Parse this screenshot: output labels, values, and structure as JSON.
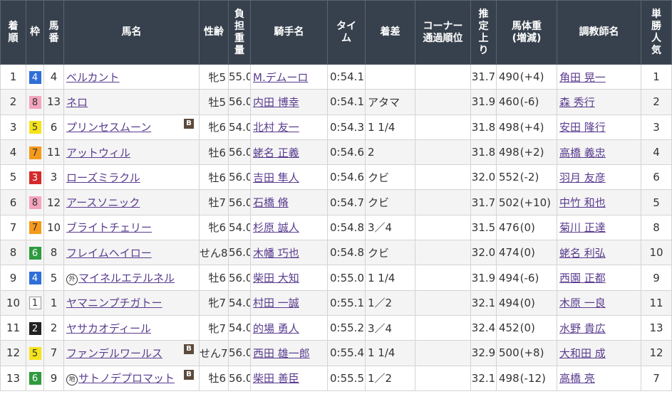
{
  "headers": {
    "finish": [
      "着",
      "順"
    ],
    "waku": [
      "枠"
    ],
    "umaban": [
      "馬",
      "番"
    ],
    "horse": [
      "馬名"
    ],
    "sexage": [
      "性齢"
    ],
    "weight": [
      "負",
      "担",
      "重",
      "量"
    ],
    "jockey": [
      "騎手名"
    ],
    "time": [
      "タイ",
      "ム"
    ],
    "margin": [
      "着差"
    ],
    "corner": [
      "コーナー",
      "通過順位"
    ],
    "last3f": [
      "推",
      "定",
      "上",
      "り"
    ],
    "bodyweight": [
      "馬体重",
      "(増減)"
    ],
    "trainer": [
      "調教師名"
    ],
    "popularity": [
      "単",
      "勝",
      "人",
      "気"
    ]
  },
  "waku_colors": {
    "1": {
      "bg": "#ffffff",
      "fg": "#333333",
      "border": "#999999"
    },
    "2": {
      "bg": "#222222",
      "fg": "#ffffff",
      "border": "#222222"
    },
    "3": {
      "bg": "#d42a2a",
      "fg": "#ffffff",
      "border": "#d42a2a"
    },
    "4": {
      "bg": "#2f6fd6",
      "fg": "#ffffff",
      "border": "#2f6fd6"
    },
    "5": {
      "bg": "#f5e21b",
      "fg": "#333333",
      "border": "#f5e21b"
    },
    "6": {
      "bg": "#2f9a3e",
      "fg": "#ffffff",
      "border": "#2f9a3e"
    },
    "7": {
      "bg": "#f59a1b",
      "fg": "#333333",
      "border": "#f59a1b"
    },
    "8": {
      "bg": "#f5a3bd",
      "fg": "#333333",
      "border": "#f5a3bd"
    }
  },
  "rows": [
    {
      "finish": "1",
      "waku": "4",
      "umaban": "4",
      "mark": "",
      "horse": "ベルカント",
      "blinker": "",
      "sexage": "牝5",
      "weight": "55.0",
      "jockey": "M.デムーロ",
      "time": "0:54.1",
      "margin": "",
      "corner": "",
      "last3f": "31.7",
      "bw": "490",
      "bwdiff": "(+4)",
      "trainer": "角田 晃一",
      "pop": "1"
    },
    {
      "finish": "2",
      "waku": "8",
      "umaban": "13",
      "mark": "",
      "horse": "ネロ",
      "blinker": "",
      "sexage": "牡5",
      "weight": "56.0",
      "jockey": "内田 博幸",
      "time": "0:54.1",
      "margin": "アタマ",
      "corner": "",
      "last3f": "31.9",
      "bw": "460",
      "bwdiff": "(-6)",
      "trainer": "森 秀行",
      "pop": "2"
    },
    {
      "finish": "3",
      "waku": "5",
      "umaban": "6",
      "mark": "",
      "horse": "プリンセスムーン",
      "blinker": "B",
      "sexage": "牝6",
      "weight": "54.0",
      "jockey": "北村 友一",
      "time": "0:54.3",
      "margin": "1 1/4",
      "corner": "",
      "last3f": "31.8",
      "bw": "498",
      "bwdiff": "(+4)",
      "trainer": "安田 隆行",
      "pop": "3"
    },
    {
      "finish": "4",
      "waku": "7",
      "umaban": "11",
      "mark": "",
      "horse": "アットウィル",
      "blinker": "",
      "sexage": "牡6",
      "weight": "56.0",
      "jockey": "蛯名 正義",
      "time": "0:54.6",
      "margin": "2",
      "corner": "",
      "last3f": "31.8",
      "bw": "498",
      "bwdiff": "(+2)",
      "trainer": "高橋 義忠",
      "pop": "4"
    },
    {
      "finish": "5",
      "waku": "3",
      "umaban": "3",
      "mark": "",
      "horse": "ローズミラクル",
      "blinker": "",
      "sexage": "牡6",
      "weight": "56.0",
      "jockey": "吉田 隼人",
      "time": "0:54.6",
      "margin": "クビ",
      "corner": "",
      "last3f": "32.0",
      "bw": "552",
      "bwdiff": "(-2)",
      "trainer": "羽月 友彦",
      "pop": "6"
    },
    {
      "finish": "6",
      "waku": "8",
      "umaban": "12",
      "mark": "",
      "horse": "アースソニック",
      "blinker": "",
      "sexage": "牡7",
      "weight": "56.0",
      "jockey": "石橋 脩",
      "time": "0:54.7",
      "margin": "クビ",
      "corner": "",
      "last3f": "31.7",
      "bw": "502",
      "bwdiff": "(+10)",
      "trainer": "中竹 和也",
      "pop": "5"
    },
    {
      "finish": "7",
      "waku": "7",
      "umaban": "10",
      "mark": "",
      "horse": "ブライトチェリー",
      "blinker": "",
      "sexage": "牝6",
      "weight": "54.0",
      "jockey": "杉原 誠人",
      "time": "0:54.8",
      "margin": "3／4",
      "corner": "",
      "last3f": "31.5",
      "bw": "476",
      "bwdiff": "(0)",
      "trainer": "菊川 正達",
      "pop": "8"
    },
    {
      "finish": "8",
      "waku": "6",
      "umaban": "8",
      "mark": "",
      "horse": "フレイムヘイロー",
      "blinker": "",
      "sexage": "せん8",
      "weight": "56.0",
      "jockey": "木幡 巧也",
      "time": "0:54.8",
      "margin": "クビ",
      "corner": "",
      "last3f": "32.0",
      "bw": "474",
      "bwdiff": "(0)",
      "trainer": "蛯名 利弘",
      "pop": "10"
    },
    {
      "finish": "9",
      "waku": "4",
      "umaban": "5",
      "mark": "外",
      "horse": "マイネルエテルネル",
      "blinker": "",
      "sexage": "牡6",
      "weight": "56.0",
      "jockey": "柴田 大知",
      "time": "0:55.0",
      "margin": "1 1/4",
      "corner": "",
      "last3f": "31.9",
      "bw": "494",
      "bwdiff": "(-6)",
      "trainer": "西園 正都",
      "pop": "9"
    },
    {
      "finish": "10",
      "waku": "1",
      "umaban": "1",
      "mark": "",
      "horse": "ヤマニンプチガトー",
      "blinker": "",
      "sexage": "牝7",
      "weight": "54.0",
      "jockey": "村田 一誠",
      "time": "0:55.1",
      "margin": "1／2",
      "corner": "",
      "last3f": "32.1",
      "bw": "494",
      "bwdiff": "(0)",
      "trainer": "木原 一良",
      "pop": "11"
    },
    {
      "finish": "11",
      "waku": "2",
      "umaban": "2",
      "mark": "",
      "horse": "ヤサカオディール",
      "blinker": "",
      "sexage": "牝7",
      "weight": "54.0",
      "jockey": "的場 勇人",
      "time": "0:55.2",
      "margin": "3／4",
      "corner": "",
      "last3f": "32.4",
      "bw": "452",
      "bwdiff": "(0)",
      "trainer": "水野 貴広",
      "pop": "13"
    },
    {
      "finish": "12",
      "waku": "5",
      "umaban": "7",
      "mark": "",
      "horse": "ファンデルワールス",
      "blinker": "B",
      "sexage": "せん7",
      "weight": "56.0",
      "jockey": "西田 雄一郎",
      "time": "0:55.4",
      "margin": "1 1/4",
      "corner": "",
      "last3f": "32.9",
      "bw": "500",
      "bwdiff": "(+8)",
      "trainer": "大和田 成",
      "pop": "12"
    },
    {
      "finish": "13",
      "waku": "6",
      "umaban": "9",
      "mark": "地",
      "horse": "サトノデプロマット",
      "blinker": "B",
      "sexage": "牡6",
      "weight": "56.0",
      "jockey": "柴田 善臣",
      "time": "0:55.5",
      "margin": "1／2",
      "corner": "",
      "last3f": "32.1",
      "bw": "498",
      "bwdiff": "(-12)",
      "trainer": "高橋 亮",
      "pop": "7"
    }
  ]
}
